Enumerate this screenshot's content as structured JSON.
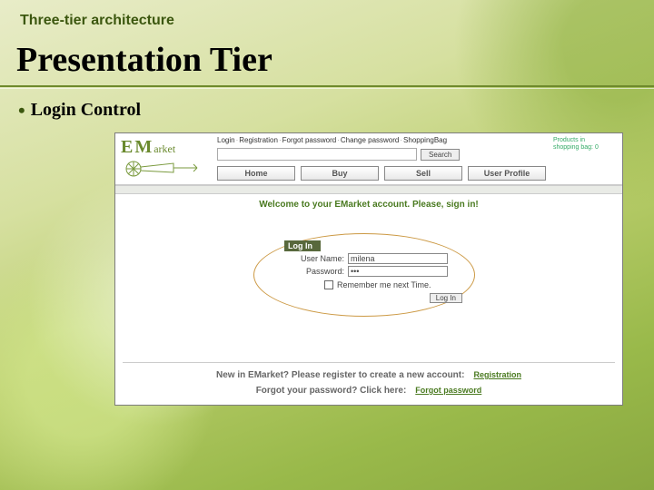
{
  "slide": {
    "kicker": "Three-tier architecture",
    "title": "Presentation Tier",
    "bullet": "Login Control"
  },
  "app": {
    "logo": {
      "cap1": "E",
      "cap2": "M",
      "rest": "arket"
    },
    "util": [
      "Login",
      "Registration",
      "Forgot password",
      "Change password",
      "ShoppingBag"
    ],
    "search_btn": "Search",
    "tabs": [
      "Home",
      "Buy",
      "Sell",
      "User Profile"
    ],
    "bag": {
      "line1": "Products in",
      "line2": "shopping bag:",
      "count": "0"
    },
    "welcome": "Welcome to your EMarket account. Please, sign in!",
    "login": {
      "header": "Log In",
      "user_label": "User Name:",
      "user_value": "milena",
      "pass_label": "Password:",
      "pass_value": "•••",
      "remember": "Remember me next Time.",
      "submit": "Log In"
    },
    "register": {
      "text": "New in EMarket? Please register to create a new account:",
      "link": "Registration"
    },
    "forgot": {
      "text": "Forgot your password? Click here:",
      "link": "Forgot password"
    }
  }
}
